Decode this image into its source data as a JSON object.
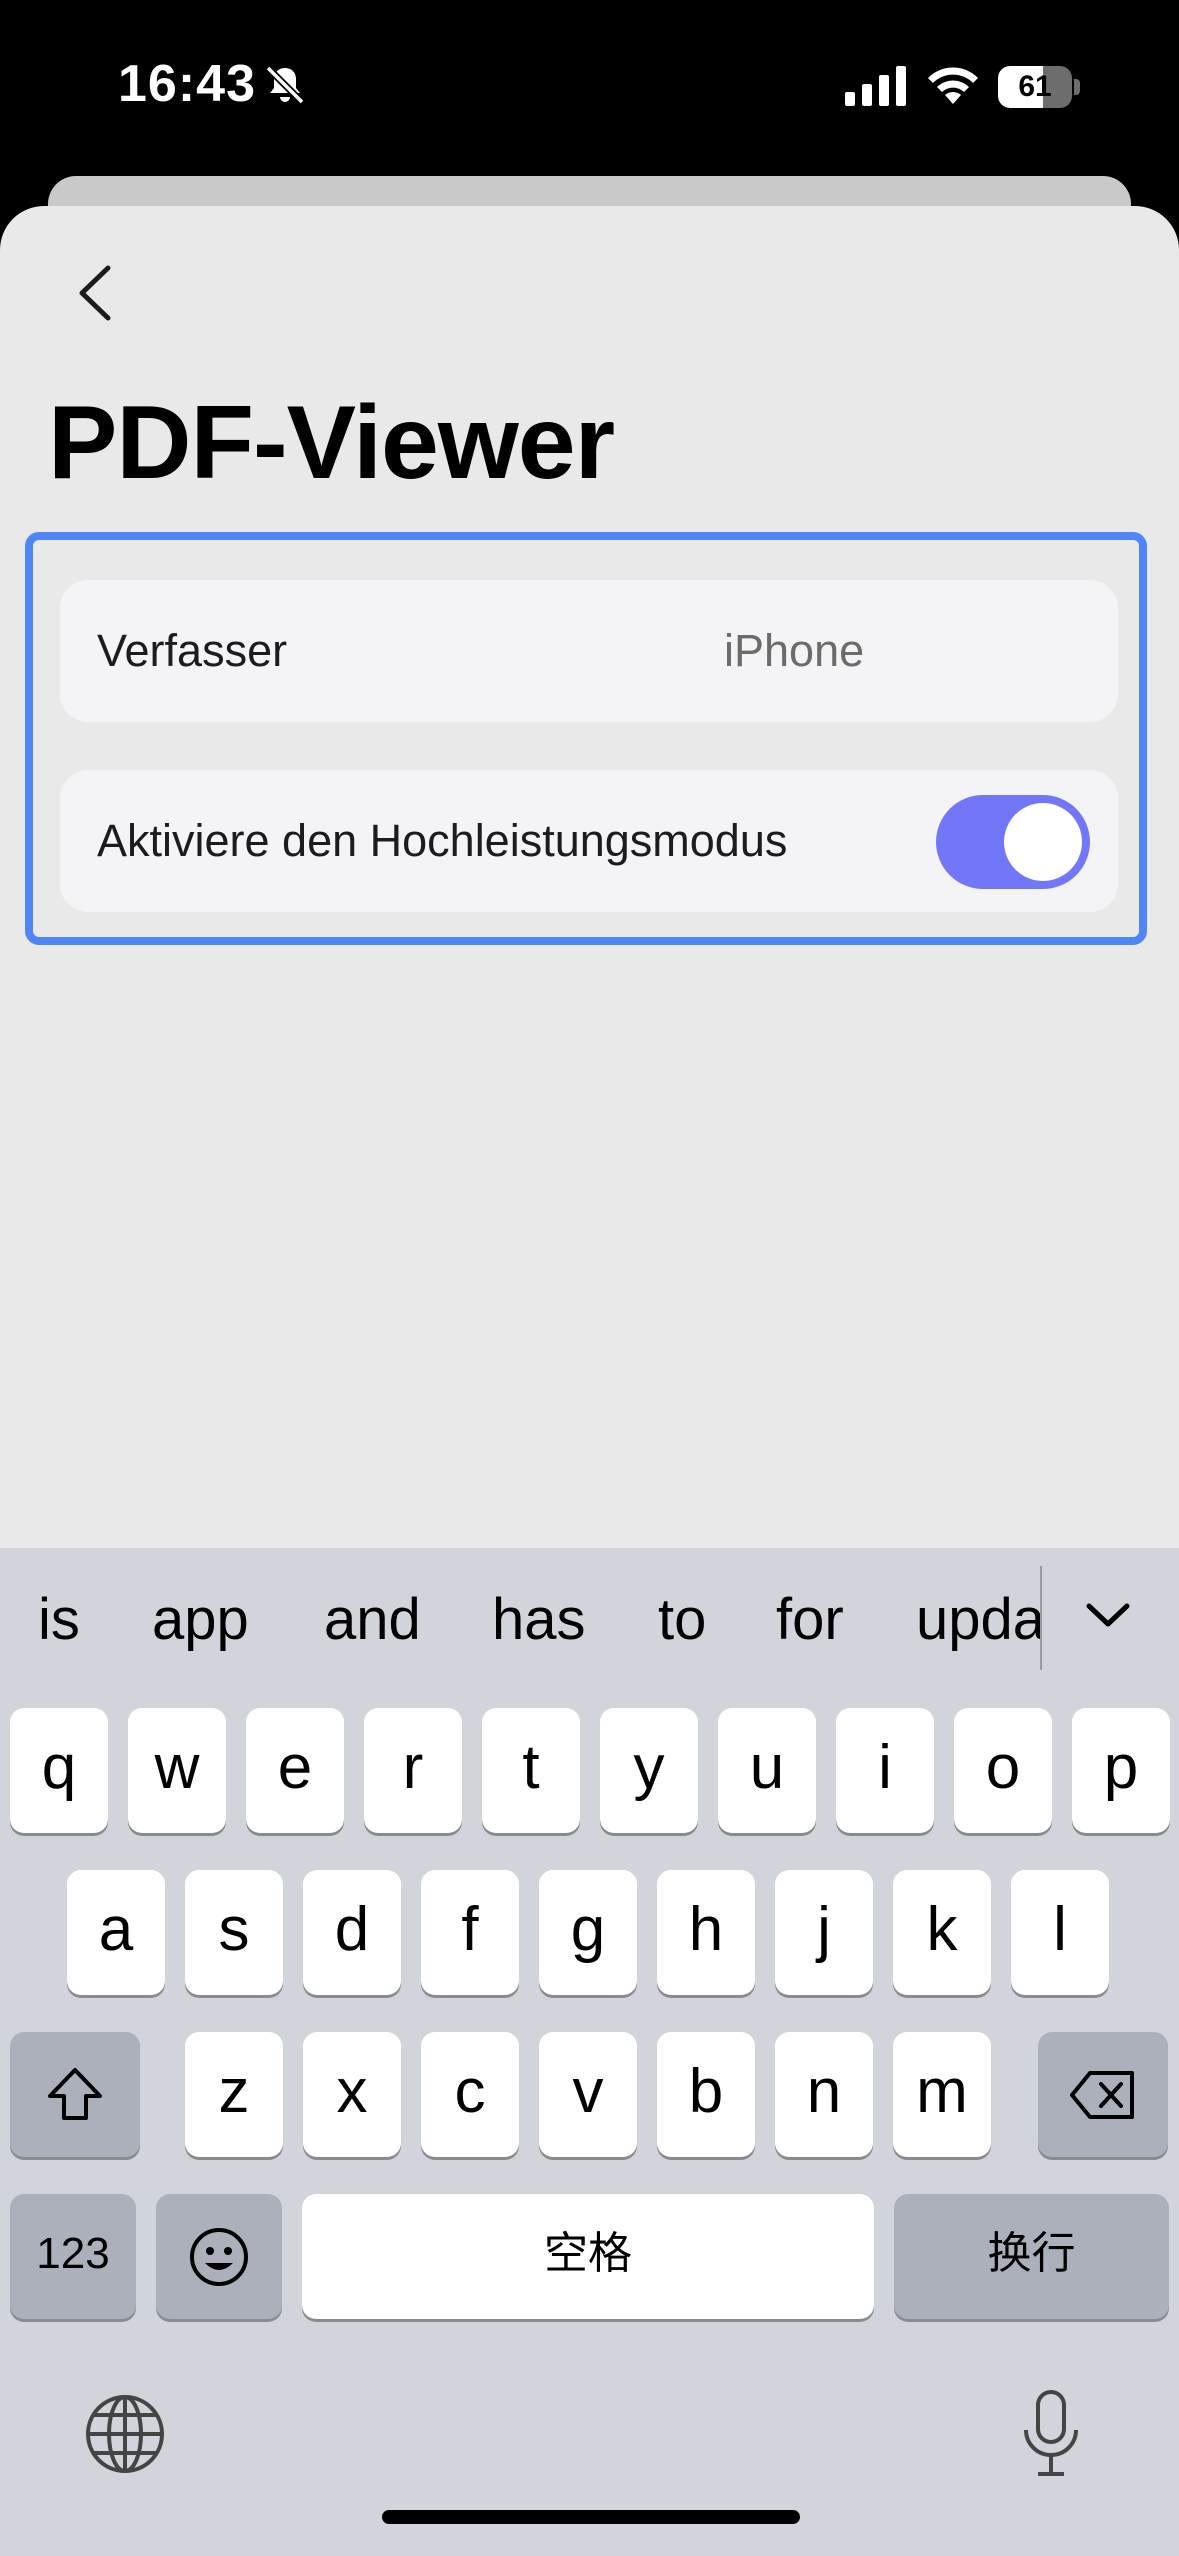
{
  "status": {
    "time": "16:43",
    "battery": "61",
    "battery_level": 0.61
  },
  "screen": {
    "title": "PDF-Viewer"
  },
  "settings": [
    {
      "label": "Verfasser",
      "value": "iPhone"
    },
    {
      "label": "Aktiviere den Hochleistungsmodus",
      "toggle_on": true
    }
  ],
  "keyboard": {
    "suggestions": [
      "is",
      "app",
      "and",
      "has",
      "to",
      "for",
      "upda"
    ],
    "row1": [
      "q",
      "w",
      "e",
      "r",
      "t",
      "y",
      "u",
      "i",
      "o",
      "p"
    ],
    "row2": [
      "a",
      "s",
      "d",
      "f",
      "g",
      "h",
      "j",
      "k",
      "l"
    ],
    "row3": [
      "z",
      "x",
      "c",
      "v",
      "b",
      "n",
      "m"
    ],
    "numbers_key": "123",
    "space_key": "空格",
    "return_key": "换行"
  },
  "colors": {
    "accent": "#7277fa",
    "highlight": "#4f86f7"
  }
}
